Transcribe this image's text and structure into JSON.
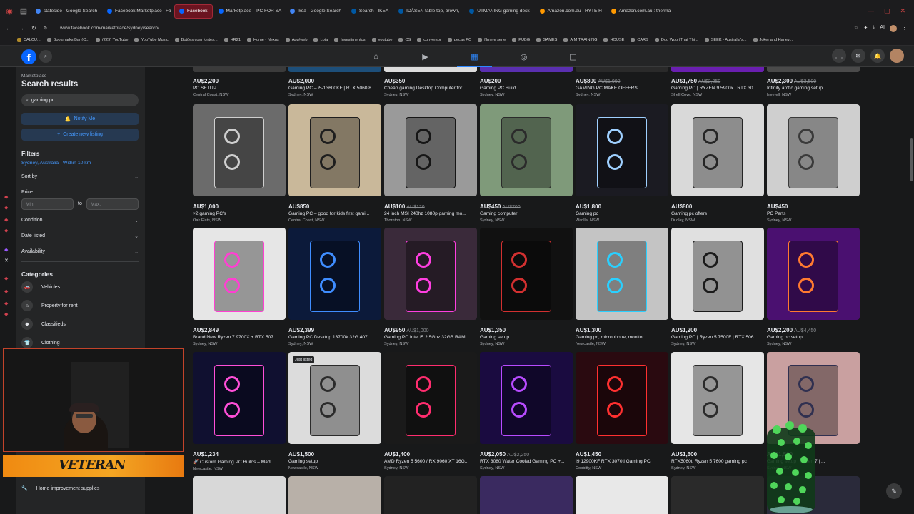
{
  "browser": {
    "tabs": [
      {
        "label": "stateside - Google Search",
        "color": "#4285f4"
      },
      {
        "label": "Facebook Marketplace | Fa",
        "color": "#0866ff"
      },
      {
        "label": "Facebook",
        "color": "#0866ff"
      },
      {
        "label": "Marketplace – PC FOR SA",
        "color": "#0866ff"
      },
      {
        "label": "Ikea - Google Search",
        "color": "#4285f4"
      },
      {
        "label": "Search - IKEA",
        "color": "#0058a3"
      },
      {
        "label": "IDÅSEN table top, brown,",
        "color": "#0058a3"
      },
      {
        "label": "UTMANING gaming desk",
        "color": "#0058a3"
      },
      {
        "label": "Amazon.com.au : HYTE H",
        "color": "#ff9900"
      },
      {
        "label": "Amazon.com.au : therma",
        "color": "#ff9900"
      }
    ],
    "active_tab_index": 2,
    "url": "www.facebook.com/marketplace/sydney/search/",
    "bookmarks": [
      "Bookmarks Bar (C...",
      "(229) YouTube",
      "YouTube Music",
      "Botões com fontes...",
      "HR21",
      "Home - Nexus",
      "App/web",
      "Loja",
      "Investimentos",
      "youtube",
      "CS",
      "conversor",
      "peças PC",
      "filme e serie",
      "PUBG",
      "GAMES",
      "AIM TRAINING",
      "HOUSE",
      "CARS",
      "Doo Wop (That Thi...",
      "SEEK - Australia's...",
      "Joker and Harley..."
    ],
    "bookmark_calcu": "CALCU...",
    "addr_right_label": "AI"
  },
  "sidebar": {
    "crumb": "Marketplace",
    "title": "Search results",
    "search_value": "gaming pc",
    "notify_label": "Notify Me",
    "create_label": "Create new listing",
    "filters_heading": "Filters",
    "location": "Sydney, Australia · Within 10 km",
    "sort_label": "Sort by",
    "price_label": "Price",
    "min_placeholder": "Min.",
    "max_placeholder": "Max.",
    "to_label": "to",
    "condition_label": "Condition",
    "date_label": "Date listed",
    "availability_label": "Availability",
    "categories_heading": "Categories",
    "categories": [
      {
        "label": "Vehicles",
        "icon": "car-icon"
      },
      {
        "label": "Property for rent",
        "icon": "house-icon"
      },
      {
        "label": "Classifieds",
        "icon": "tag-icon"
      },
      {
        "label": "Clothing",
        "icon": "shirt-icon"
      }
    ],
    "home_improvement": "Home improvement supplies"
  },
  "webcam": {
    "banner_text": "VETERAN"
  },
  "top_row": [
    {
      "price": "AU$2,200",
      "old": "",
      "title": "PC SETUP",
      "loc": "Central Coast, NSW",
      "color": "#3b3b3b"
    },
    {
      "price": "AU$2,000",
      "old": "",
      "title": "Gaming PC – i5-13600KF | RTX 5060 8...",
      "loc": "Sydney, NSW",
      "color": "#1d4f7a"
    },
    {
      "price": "AU$350",
      "old": "",
      "title": "Cheap gaming Desktop Computer for...",
      "loc": "Sydney, NSW",
      "color": "#dcdcdc"
    },
    {
      "price": "AU$200",
      "old": "",
      "title": "Gaming PC Build",
      "loc": "Sydney, NSW",
      "color": "#5a2fb0"
    },
    {
      "price": "AU$800",
      "old": "AU$1,000",
      "title": "GAMING PC MAKE OFFERS",
      "loc": "Sydney, NSW",
      "color": "#2a2a2a"
    },
    {
      "price": "AU$1,750",
      "old": "AU$2,250",
      "title": "Gaming PC | RYZEN 9 5900x | RTX 30...",
      "loc": "Shell Cove, NSW",
      "color": "#6a1fb0"
    },
    {
      "price": "AU$2,300",
      "old": "AU$3,500",
      "title": "Infinity arctic gaming setup",
      "loc": "Inverell, NSW",
      "color": "#4a4a4a"
    }
  ],
  "rows": [
    [
      {
        "price": "AU$1,000",
        "old": "",
        "title": "×2 gaming PC's",
        "loc": "Oak Flats, NSW",
        "bg": "#6b6b6b",
        "accent": "#cfcfcf"
      },
      {
        "price": "AU$850",
        "old": "",
        "title": "Gaming PC – good for kids first gami...",
        "loc": "Central Coast, NSW",
        "bg": "#c9b89a",
        "accent": "#1e1e1e"
      },
      {
        "price": "AU$100",
        "old": "AU$120",
        "title": "24 inch MSI 240hz 1080p gaming mo...",
        "loc": "Thornton, NSW",
        "bg": "#9a9a9a",
        "accent": "#161616"
      },
      {
        "price": "AU$450",
        "old": "AU$700",
        "title": "Gaming computer",
        "loc": "Sydney, NSW",
        "bg": "#7f9a7a",
        "accent": "#2b2b2b"
      },
      {
        "price": "AU$1,800",
        "old": "",
        "title": "Gaming pc",
        "loc": "Warilla, NSW",
        "bg": "#1b1b22",
        "accent": "#9fd0ff"
      },
      {
        "price": "AU$800",
        "old": "",
        "title": "Gaming pc offers",
        "loc": "Dudley, NSW",
        "bg": "#d9d9d9",
        "accent": "#252525"
      },
      {
        "price": "AU$450",
        "old": "",
        "title": "PC Parts",
        "loc": "Sydney, NSW",
        "bg": "#cfcfcf",
        "accent": "#3a3a3a"
      }
    ],
    [
      {
        "price": "AU$2,849",
        "old": "",
        "title": "Brand New Ryzen 7 9700X + RTX 507...",
        "loc": "Sydney, NSW",
        "bg": "#e6e6e6",
        "accent": "#ff3fd2"
      },
      {
        "price": "AU$2,399",
        "old": "",
        "title": "Gaming PC Desktop 13700k 32G 407...",
        "loc": "Sydney, NSW",
        "bg": "#0c1a3a",
        "accent": "#3f8dff"
      },
      {
        "price": "AU$950",
        "old": "AU$1,000",
        "title": "Gaming PC Intel i5 2.5Ghz 32GB RAM...",
        "loc": "Sydney, NSW",
        "bg": "#3a2a3a",
        "accent": "#ff3fe0"
      },
      {
        "price": "AU$1,350",
        "old": "",
        "title": "Gaming setup",
        "loc": "Sydney, NSW",
        "bg": "#111111",
        "accent": "#d23030"
      },
      {
        "price": "AU$1,300",
        "old": "",
        "title": "Gaming pc, microphone, monitor",
        "loc": "Newcastle, NSW",
        "bg": "#c4c4c4",
        "accent": "#2ad0ff"
      },
      {
        "price": "AU$1,200",
        "old": "",
        "title": "Gaming PC | Ryzen 5 7500F | RTX 506...",
        "loc": "Sydney, NSW",
        "bg": "#e0e0e0",
        "accent": "#1b1b1b"
      },
      {
        "price": "AU$2,200",
        "old": "AU$4,450",
        "title": "Gaming pc setup",
        "loc": "Sydney, NSW",
        "bg": "#4a1070",
        "accent": "#ff7a30"
      }
    ],
    [
      {
        "price": "AU$1,234",
        "old": "",
        "title": "🚀 Custom Gaming PC Builds – Mad...",
        "loc": "Newcastle, NSW",
        "bg": "#101030",
        "accent": "#ff4fd8",
        "badge": ""
      },
      {
        "price": "AU$1,500",
        "old": "",
        "title": "Gaming setup",
        "loc": "Newcastle, NSW",
        "bg": "#dcdcdc",
        "accent": "#2b2b2b",
        "badge": "Just listed"
      },
      {
        "price": "AU$1,400",
        "old": "",
        "title": "AMD Ryzen 5 5600 / RX 9060 XT 16G...",
        "loc": "Sydney, NSW",
        "bg": "#1a1a1a",
        "accent": "#ff2d6f",
        "badge": ""
      },
      {
        "price": "AU$2,050",
        "old": "AU$2,250",
        "title": "RTX 3080 Water Cooled Gaming PC +...",
        "loc": "Sydney, NSW",
        "bg": "#1a0b40",
        "accent": "#b84bff",
        "badge": ""
      },
      {
        "price": "AU$1,450",
        "old": "",
        "title": "I9 12900KF RTX 3070ti Gaming PC",
        "loc": "Cobbitty, NSW",
        "bg": "#2a0a10",
        "accent": "#ff3030",
        "badge": ""
      },
      {
        "price": "AU$1,600",
        "old": "",
        "title": "RTX5060ti Ryzen 5 7600 gaming pc",
        "loc": "Sydney, NSW",
        "bg": "#e6e6e6",
        "accent": "#2b2b2b",
        "badge": ""
      },
      {
        "price": "AU$1,500",
        "old": "",
        "title": "Gaming setup | Ryzen 7 | ...",
        "loc": "Sydney, NSW",
        "bg": "#c9a0a0",
        "accent": "#303050",
        "badge": ""
      }
    ]
  ],
  "bottom_row_colors": [
    "#d8d8d8",
    "#b8b0a8",
    "#222222",
    "#3a2a60",
    "#e8e8e8",
    "#2a2a2a",
    "#2a2a3a"
  ]
}
